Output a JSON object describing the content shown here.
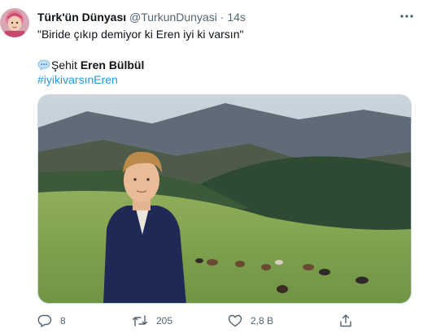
{
  "tweet": {
    "display_name": "Türk'ün Dünyası",
    "handle": "@TurkunDunyasi",
    "separator": "·",
    "time": "14s",
    "quote_text": "\"Biride çıkıp demiyor ki Eren iyi ki varsın\"",
    "line2_prefix": "Şehit",
    "line2_bold": "Eren Bülbül",
    "hashtag": "#iyikivarsınEren"
  },
  "actions": {
    "reply_count": "8",
    "retweet_count": "205",
    "like_count": "2,8 B"
  },
  "icons": {
    "avatar": "profile-avatar",
    "more": "more-horizontal-icon",
    "speech": "speech-balloon-icon",
    "reply": "reply-icon",
    "retweet": "retweet-icon",
    "like": "heart-icon",
    "share": "share-icon"
  },
  "colors": {
    "link": "#1d9bf0",
    "muted": "#536471",
    "text": "#0f1419"
  }
}
